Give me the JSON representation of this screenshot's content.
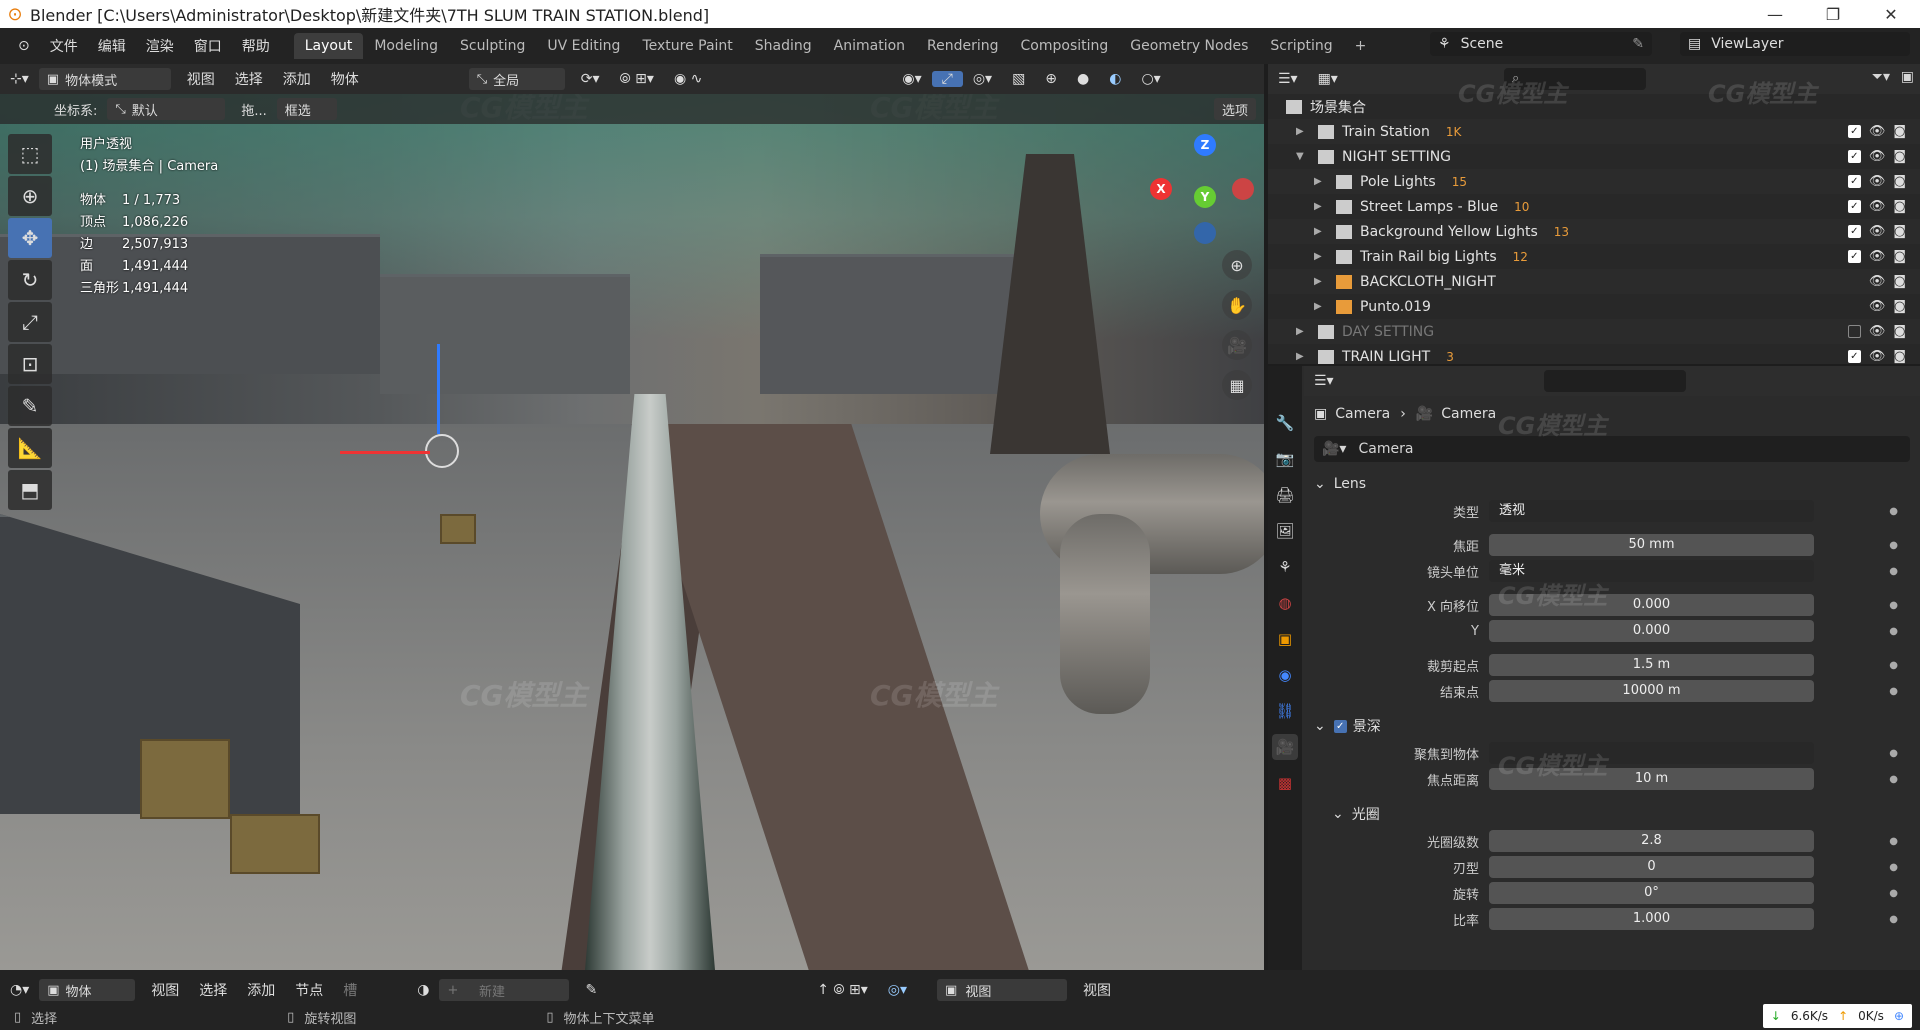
{
  "window": {
    "title": "Blender [C:\\Users\\Administrator\\Desktop\\新建文件夹\\7TH SLUM TRAIN STATION.blend]"
  },
  "menu": [
    "文件",
    "编辑",
    "渲染",
    "窗口",
    "帮助"
  ],
  "workspaces": [
    "Layout",
    "Modeling",
    "Sculpting",
    "UV Editing",
    "Texture Paint",
    "Shading",
    "Animation",
    "Rendering",
    "Compositing",
    "Geometry Nodes",
    "Scripting"
  ],
  "scene": {
    "name": "Scene",
    "view_layer": "ViewLayer"
  },
  "viewport_header": {
    "mode": "物体模式",
    "menus": [
      "视图",
      "选择",
      "添加",
      "物体"
    ],
    "transform": "全局",
    "options": "选项"
  },
  "viewport_header2": {
    "coord_label": "坐标系:",
    "coord_value": "默认",
    "drag_label": "拖...",
    "drag_value": "框选"
  },
  "overlay": {
    "view_name": "用户透视",
    "collection": "(1) 场景集合 | Camera",
    "stats": [
      {
        "k": "物体",
        "v": "1 / 1,773"
      },
      {
        "k": "顶点",
        "v": "1,086,226"
      },
      {
        "k": "边",
        "v": "2,507,913"
      },
      {
        "k": "面",
        "v": "1,491,444"
      },
      {
        "k": "三角形",
        "v": "1,491,444"
      }
    ]
  },
  "gizmo": {
    "x": "X",
    "y": "Y",
    "z": "Z"
  },
  "outliner": {
    "root": "场景集合",
    "rows": [
      {
        "name": "Train Station",
        "badge": "1K",
        "indent": 1,
        "checked": true
      },
      {
        "name": "NIGHT SETTING",
        "badge": "",
        "indent": 1,
        "checked": true
      },
      {
        "name": "Pole Lights",
        "badge": "15",
        "indent": 2,
        "checked": true
      },
      {
        "name": "Street Lamps - Blue",
        "badge": "10",
        "indent": 2,
        "checked": true
      },
      {
        "name": "Background Yellow Lights",
        "badge": "13",
        "indent": 2,
        "checked": true
      },
      {
        "name": "Train Rail big Lights",
        "badge": "12",
        "indent": 2,
        "checked": true
      },
      {
        "name": "BACKCLOTH_NIGHT",
        "badge": "",
        "indent": 2,
        "checked": false
      },
      {
        "name": "Punto.019",
        "badge": "",
        "indent": 2,
        "checked": false
      },
      {
        "name": "DAY SETTING",
        "badge": "",
        "indent": 1,
        "checked": false,
        "dim": true
      },
      {
        "name": "TRAIN LIGHT",
        "badge": "3",
        "indent": 1,
        "checked": true
      }
    ]
  },
  "properties": {
    "breadcrumb_obj": "Camera",
    "breadcrumb_data": "Camera",
    "datablock": "Camera",
    "lens_panel": "Lens",
    "fields": [
      {
        "label": "类型",
        "value": "透视",
        "type": "select"
      },
      {
        "label": "焦距",
        "value": "50 mm"
      },
      {
        "label": "镜头单位",
        "value": "毫米",
        "type": "select"
      },
      {
        "label": "X 向移位",
        "value": "0.000"
      },
      {
        "label": "Y",
        "value": "0.000"
      },
      {
        "label": "裁剪起点",
        "value": "1.5 m"
      },
      {
        "label": "结束点",
        "value": "10000 m"
      }
    ],
    "dof_panel": "景深",
    "dof_fields": [
      {
        "label": "聚焦到物体",
        "value": "",
        "type": "select"
      },
      {
        "label": "焦点距离",
        "value": "10 m"
      }
    ],
    "aperture_panel": "光圈",
    "aperture_fields": [
      {
        "label": "光圈级数",
        "value": "2.8"
      },
      {
        "label": "刃型",
        "value": "0"
      },
      {
        "label": "旋转",
        "value": "0°"
      },
      {
        "label": "比率",
        "value": "1.000"
      }
    ]
  },
  "footer": {
    "mode": "物体",
    "menus": [
      "视图",
      "选择",
      "添加",
      "节点"
    ],
    "slot": "槽",
    "new": "新建",
    "view": "视图",
    "view2": "视图"
  },
  "status": {
    "select": "选择",
    "rotate": "旋转视图",
    "context": "物体上下文菜单",
    "down": "6.6K/s",
    "up": "0K/s"
  },
  "watermark": "CG模型主"
}
